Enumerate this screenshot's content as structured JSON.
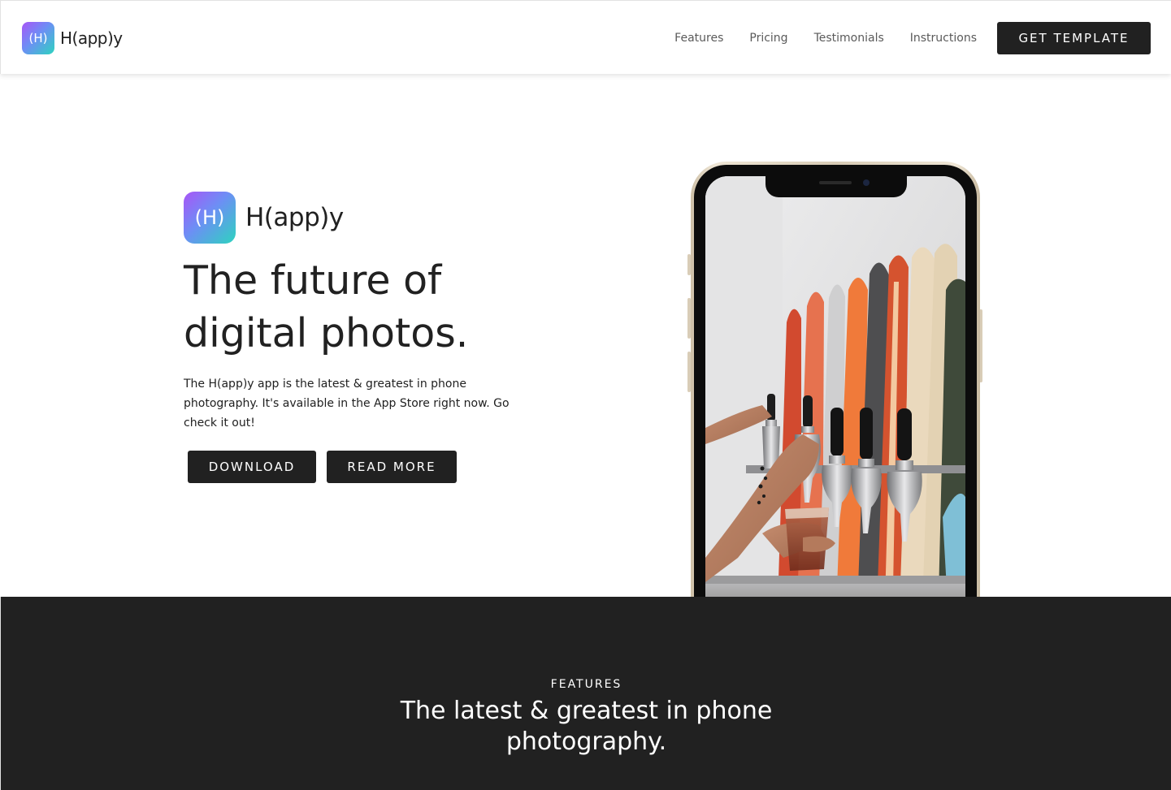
{
  "nav": {
    "logo_icon_text": "(H)",
    "brand": "H(app)y",
    "links": [
      "Features",
      "Pricing",
      "Testimonials",
      "Instructions"
    ],
    "cta_label": "GET TEMPLATE"
  },
  "hero": {
    "logo_icon_text": "(H)",
    "brand": "H(app)y",
    "title": "The future of digital photos.",
    "description": "The H(app)y app is the latest & greatest in phone photography. It's available in the App Store right now. Go check it out!",
    "primary_button": "DOWNLOAD",
    "secondary_button": "READ MORE"
  },
  "features": {
    "eyebrow": "FEATURES",
    "title": "The latest & greatest in phone photography."
  },
  "colors": {
    "dark": "#212121",
    "icon_gradient": [
      "#a855f7",
      "#6d8ef5",
      "#2dd4bf"
    ]
  }
}
